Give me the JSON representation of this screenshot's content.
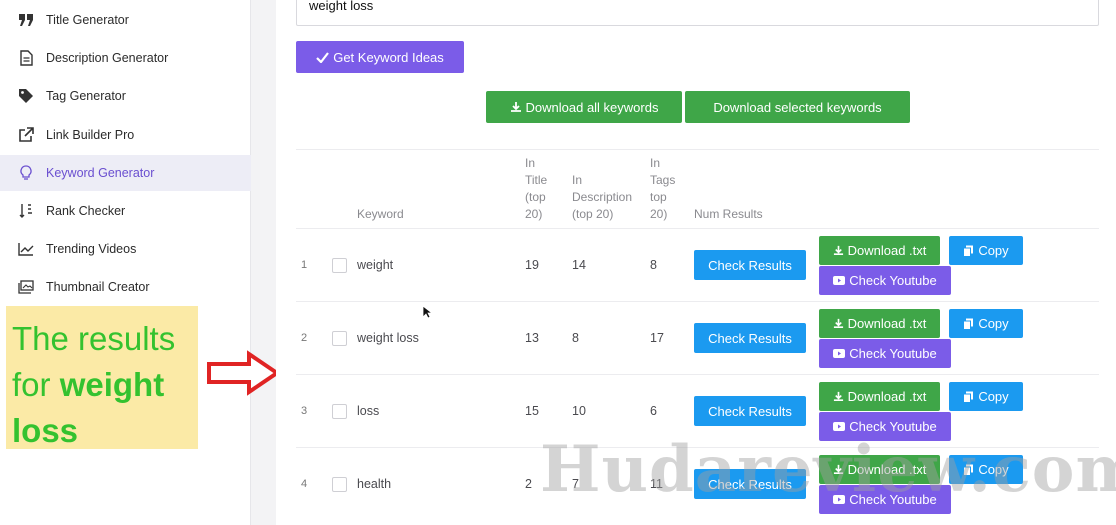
{
  "sidebar": {
    "items": [
      {
        "label": "Title Generator",
        "icon": "quote-icon",
        "active": false
      },
      {
        "label": "Description Generator",
        "icon": "document-icon",
        "active": false
      },
      {
        "label": "Tag Generator",
        "icon": "tag-icon",
        "active": false
      },
      {
        "label": "Link Builder Pro",
        "icon": "external-link-icon",
        "active": false
      },
      {
        "label": "Keyword Generator",
        "icon": "lightbulb-icon",
        "active": true
      },
      {
        "label": "Rank Checker",
        "icon": "sort-icon",
        "active": false
      },
      {
        "label": "Trending Videos",
        "icon": "trend-chart-icon",
        "active": false
      },
      {
        "label": "Thumbnail Creator",
        "icon": "image-icon",
        "active": false
      }
    ]
  },
  "callout": {
    "line1": "The results",
    "line2_plain": "for ",
    "line2_bold": "weight",
    "line3_bold": "loss"
  },
  "search": {
    "value": "weight loss"
  },
  "buttons": {
    "get_ideas": "Get Keyword Ideas",
    "download_all": "Download all keywords",
    "download_selected": "Download selected keywords"
  },
  "table": {
    "headers": {
      "keyword": "Keyword",
      "in_title": [
        "In",
        "Title",
        "(top",
        "20)"
      ],
      "in_description": [
        "In",
        "Description",
        "(top 20)"
      ],
      "in_tags": [
        "In",
        "Tags",
        "top",
        "20)"
      ],
      "num_results": "Num Results"
    },
    "row_actions": {
      "check_results": "Check Results",
      "download_txt": "Download .txt",
      "copy": "Copy",
      "check_youtube": "Check Youtube"
    },
    "rows": [
      {
        "index": "1",
        "keyword": "weight",
        "in_title": "19",
        "in_description": "14",
        "in_tags": "8"
      },
      {
        "index": "2",
        "keyword": "weight loss",
        "in_title": "13",
        "in_description": "8",
        "in_tags": "17"
      },
      {
        "index": "3",
        "keyword": "loss",
        "in_title": "15",
        "in_description": "10",
        "in_tags": "6"
      },
      {
        "index": "4",
        "keyword": "health",
        "in_title": "2",
        "in_description": "7",
        "in_tags": "11"
      }
    ]
  },
  "watermark": "Hudareview.com",
  "colors": {
    "purple": "#7b5ce8",
    "green": "#3fa648",
    "blue": "#1b9af0",
    "callout_bg": "#fbeaa6",
    "callout_text": "#34c22f",
    "arrow": "#e02424"
  }
}
